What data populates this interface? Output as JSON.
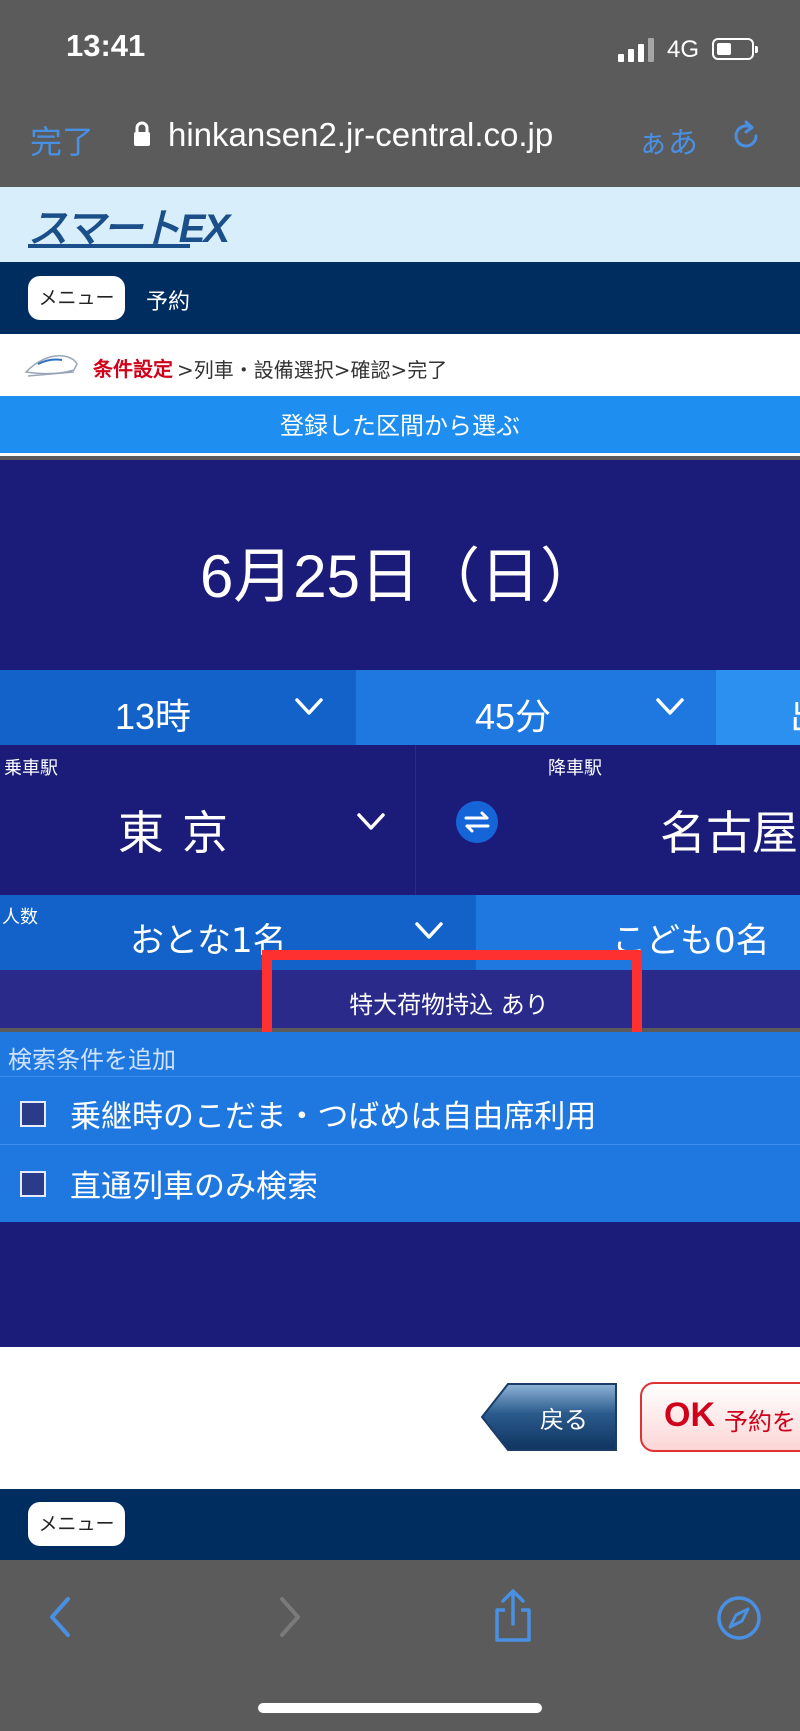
{
  "status_bar": {
    "time": "13:41",
    "network": "4G"
  },
  "browser": {
    "done_label": "完了",
    "url": "hinkansen2.jr-central.co.jp",
    "text_size_label": "ぁあ"
  },
  "site": {
    "logo": "スマートEX",
    "menu_label": "メニュー",
    "page_label": "予約",
    "breadcrumb": {
      "current": "条件設定",
      "rest": ">列車・設備選択>確認>完了"
    },
    "registered_routes": "登録した区間から選ぶ"
  },
  "search": {
    "date": "6月25日（日）",
    "hour": "13時",
    "minute": "45分",
    "extra": "出",
    "departure_label": "乗車駅",
    "departure_station": "東京",
    "arrival_label": "降車駅",
    "arrival_station": "名古屋",
    "people_label": "人数",
    "adults": "おとな1名",
    "children": "こども0名",
    "luggage": "特大荷物持込 あり",
    "options_header": "検索条件を追加",
    "options": [
      {
        "label": "乗継時のこだま・つばめは自由席利用",
        "checked": false
      },
      {
        "label": "直通列車のみ検索",
        "checked": false
      }
    ]
  },
  "actions": {
    "back_label": "戻る",
    "ok_label": "OK",
    "ok_rest": "予約を"
  },
  "colors": {
    "accent_blue": "#1e78e0",
    "navy": "#002d5f",
    "panel": "#1b1b7a",
    "highlight": "#ff3030"
  }
}
